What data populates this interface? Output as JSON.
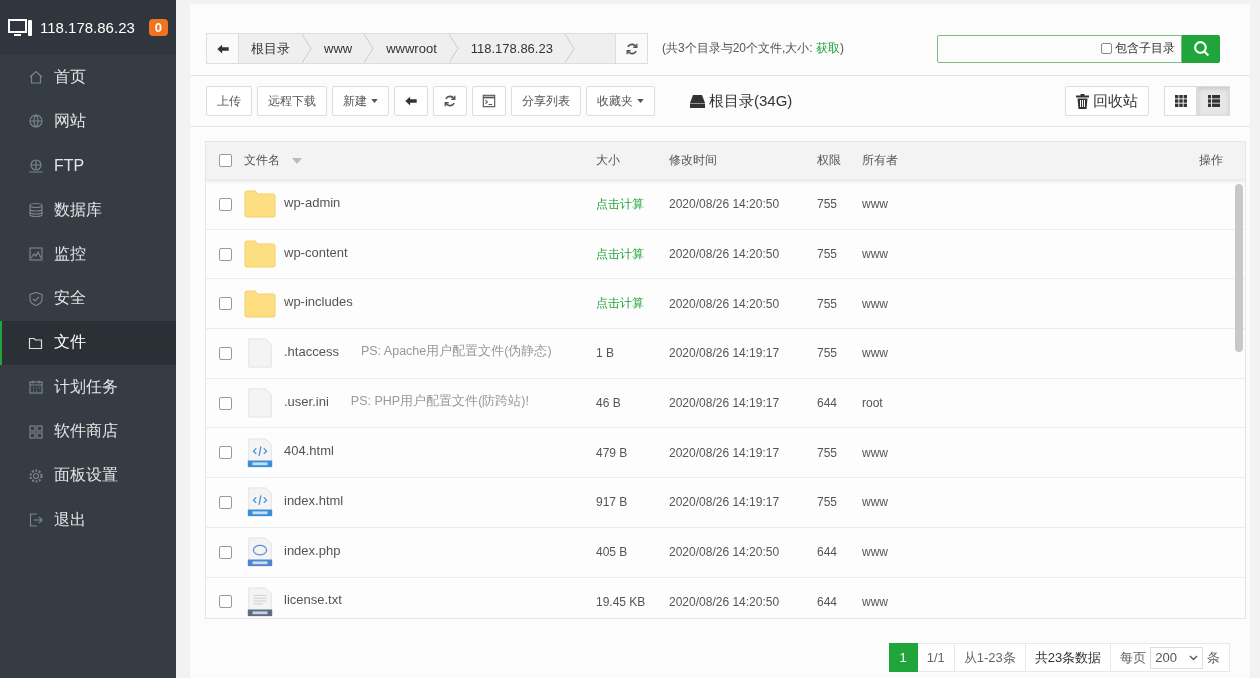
{
  "sidebar": {
    "host": "118.178.86.23",
    "badge": "0",
    "items": [
      {
        "label": "首页",
        "kind": "home",
        "selected": false
      },
      {
        "label": "网站",
        "kind": "globe",
        "selected": false
      },
      {
        "label": "FTP",
        "kind": "network",
        "selected": false
      },
      {
        "label": "数据库",
        "kind": "database",
        "selected": false
      },
      {
        "label": "监控",
        "kind": "chart",
        "selected": false
      },
      {
        "label": "安全",
        "kind": "shield",
        "selected": false
      },
      {
        "label": "文件",
        "kind": "folder",
        "selected": true
      },
      {
        "label": "计划任务",
        "kind": "calendar",
        "selected": false
      },
      {
        "label": "软件商店",
        "kind": "apps",
        "selected": false
      },
      {
        "label": "面板设置",
        "kind": "gear",
        "selected": false
      },
      {
        "label": "退出",
        "kind": "logout",
        "selected": false
      }
    ]
  },
  "breadcrumb": {
    "segments": [
      "根目录",
      "www",
      "wwwroot",
      "118.178.86.23"
    ]
  },
  "summary": {
    "prefix": "(共3个目录与20个文件,大小: ",
    "link": "获取",
    "suffix": ")"
  },
  "search": {
    "option": {
      "label": "包含子目录",
      "checked": false
    }
  },
  "toolbar": [
    {
      "kind": "text",
      "label": "上传"
    },
    {
      "kind": "text",
      "label": "远程下载"
    },
    {
      "kind": "dropdown",
      "label": "新建"
    },
    {
      "kind": "back"
    },
    {
      "kind": "refresh"
    },
    {
      "kind": "terminal"
    },
    {
      "kind": "text",
      "label": "分享列表"
    },
    {
      "kind": "dropdown",
      "label": "收藏夹"
    }
  ],
  "disk": "根目录(34G)",
  "recycle": "回收站",
  "views": [
    {
      "kind": "grid",
      "selected": false
    },
    {
      "kind": "list",
      "selected": true
    }
  ],
  "table": {
    "select_all_checked": false,
    "columns": [
      "文件名",
      "大小",
      "修改时间",
      "权限",
      "所有者",
      "操作"
    ],
    "rows": [
      {
        "checked": false,
        "kind": "folder",
        "name": "wp-admin",
        "size": "点击计算",
        "size_is_link": true,
        "modified": "2020/08/26 14:20:50",
        "permissions": "755",
        "owner": "www"
      },
      {
        "checked": false,
        "kind": "folder",
        "name": "wp-content",
        "size": "点击计算",
        "size_is_link": true,
        "modified": "2020/08/26 14:20:50",
        "permissions": "755",
        "owner": "www"
      },
      {
        "checked": false,
        "kind": "folder",
        "name": "wp-includes",
        "size": "点击计算",
        "size_is_link": true,
        "modified": "2020/08/26 14:20:50",
        "permissions": "755",
        "owner": "www"
      },
      {
        "checked": false,
        "kind": "blank",
        "name": ".htaccess",
        "note": "PS: Apache用户配置文件(伪静态)",
        "size": "1 B",
        "size_is_link": false,
        "modified": "2020/08/26 14:19:17",
        "permissions": "755",
        "owner": "www"
      },
      {
        "checked": false,
        "kind": "blank",
        "name": ".user.ini",
        "note": "PS: PHP用户配置文件(防跨站)!",
        "size": "46 B",
        "size_is_link": false,
        "modified": "2020/08/26 14:19:17",
        "permissions": "644",
        "owner": "root"
      },
      {
        "checked": false,
        "kind": "html",
        "name": "404.html",
        "size": "479 B",
        "size_is_link": false,
        "modified": "2020/08/26 14:19:17",
        "permissions": "755",
        "owner": "www"
      },
      {
        "checked": false,
        "kind": "html",
        "name": "index.html",
        "size": "917 B",
        "size_is_link": false,
        "modified": "2020/08/26 14:19:17",
        "permissions": "755",
        "owner": "www"
      },
      {
        "checked": false,
        "kind": "php",
        "name": "index.php",
        "size": "405 B",
        "size_is_link": false,
        "modified": "2020/08/26 14:20:50",
        "permissions": "644",
        "owner": "www"
      },
      {
        "checked": false,
        "kind": "txt",
        "name": "license.txt",
        "size": "19.45 KB",
        "size_is_link": false,
        "modified": "2020/08/26 14:20:50",
        "permissions": "644",
        "owner": "www"
      }
    ]
  },
  "pagination": {
    "current": "1",
    "pages": "1/1",
    "range": "从1-23条",
    "total": "共23条数据",
    "per_page_label": "每页",
    "per_page": "200",
    "unit": "条"
  }
}
